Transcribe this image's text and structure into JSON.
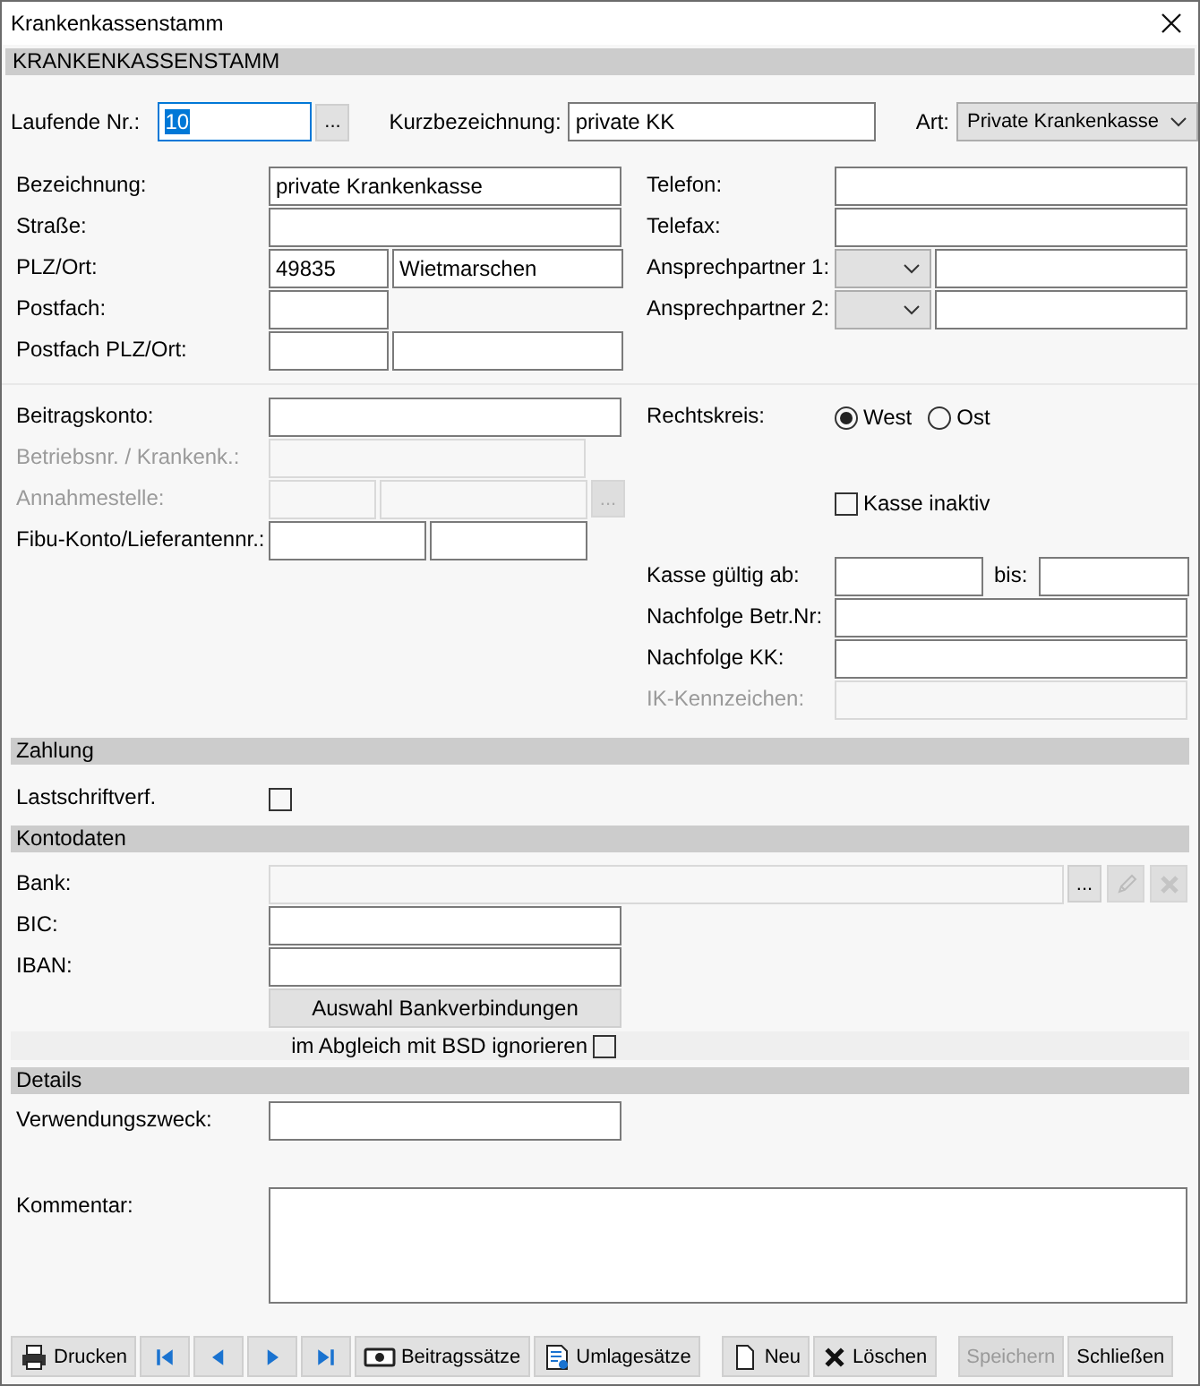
{
  "window": {
    "title": "Krankenkassenstamm"
  },
  "header": "KRANKENKASSENSTAMM",
  "top_row": [
    {
      "label": "Laufende Nr.:",
      "kind": "number-lookup",
      "value": "10",
      "text_selected": true,
      "button": "..."
    },
    {
      "label": "Kurzbezeichnung:",
      "kind": "text",
      "value": "private KK"
    },
    {
      "label": "Art:",
      "kind": "select",
      "value": "Private Krankenkasse"
    }
  ],
  "address": {
    "left": [
      {
        "label": "Bezeichnung:",
        "kind": "wide",
        "values": [
          "private Krankenkasse"
        ]
      },
      {
        "label": "Straße:",
        "kind": "wide"
      },
      {
        "label": "PLZ/Ort:",
        "kind": "pair",
        "values": [
          "49835",
          "Wietmarschen"
        ]
      },
      {
        "label": "Postfach:",
        "kind": "short"
      },
      {
        "label": "Postfach PLZ/Ort:",
        "kind": "pair"
      }
    ],
    "right": [
      {
        "label": "Telefon:",
        "kind": "wide"
      },
      {
        "label": "Telefax:",
        "kind": "wide"
      },
      {
        "label": "Ansprechpartner 1:",
        "kind": "select-text"
      },
      {
        "label": "Ansprechpartner 2:",
        "kind": "select-text"
      }
    ]
  },
  "accounts": {
    "left": [
      {
        "label": "Beitragskonto:",
        "kind": "wide"
      },
      {
        "label": "Betriebsnr. / Krankenk.:",
        "kind": "medium",
        "disabled": true
      },
      {
        "label": "Annahmestelle:",
        "kind": "pair-button",
        "disabled": true,
        "button": "..."
      },
      {
        "label": "Fibu-Konto/Lieferantennr.:",
        "kind": "pair-even"
      }
    ],
    "right": [
      {
        "label": "Rechtskreis:",
        "kind": "radio",
        "options": [
          {
            "label": "West",
            "selected": true
          },
          {
            "label": "Ost",
            "selected": false
          }
        ]
      },
      {
        "kind": "checkbox",
        "text": "Kasse inaktiv",
        "checked": false
      },
      {
        "label": "Kasse gültig ab:",
        "kind": "date-range",
        "to_label": "bis:"
      },
      {
        "label": "Nachfolge Betr.Nr:",
        "kind": "wide"
      },
      {
        "label": "Nachfolge KK:",
        "kind": "wide"
      },
      {
        "label": "IK-Kennzeichen:",
        "kind": "wide",
        "disabled": true
      }
    ]
  },
  "zahlung": {
    "title": "Zahlung",
    "rows": [
      {
        "label": "Lastschriftverf.",
        "kind": "check",
        "checked": false
      }
    ]
  },
  "kontodaten": {
    "title": "Kontodaten",
    "rows": [
      {
        "label": "Bank:",
        "kind": "bank",
        "button": "..."
      },
      {
        "label": "BIC:",
        "kind": "wide"
      },
      {
        "label": "IBAN:",
        "kind": "wide"
      },
      {
        "kind": "action",
        "text": "Auswahl Bankverbindungen"
      },
      {
        "kind": "inline-check",
        "text": "im Abgleich mit BSD ignorieren",
        "checked": false
      }
    ]
  },
  "details": {
    "title": "Details",
    "rows": [
      {
        "label": "Verwendungszweck:",
        "kind": "wide"
      },
      {
        "label": "Kommentar:",
        "kind": "textarea"
      }
    ]
  },
  "toolbar": {
    "navigation": [
      {
        "kind": "printer",
        "label": "Drucken",
        "disabled": false
      },
      {
        "kind": "first",
        "disabled": false
      },
      {
        "kind": "prev",
        "disabled": false
      },
      {
        "kind": "next",
        "disabled": false
      },
      {
        "kind": "last",
        "disabled": false
      },
      {
        "kind": "money",
        "label": "Beitragssätze",
        "disabled": false
      },
      {
        "kind": "sheet",
        "label": "Umlagesätze",
        "disabled": false
      }
    ],
    "record": [
      {
        "kind": "page",
        "label": "Neu",
        "disabled": false
      },
      {
        "kind": "cross",
        "label": "Löschen",
        "disabled": false
      }
    ],
    "dialog": [
      {
        "label": "Speichern",
        "disabled": true
      },
      {
        "label": "Schließen",
        "disabled": false
      }
    ]
  }
}
